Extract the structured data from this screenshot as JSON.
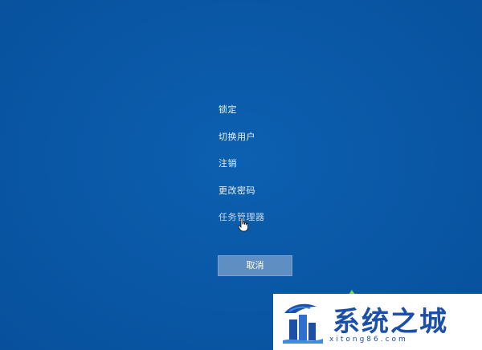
{
  "menu": {
    "items": [
      {
        "label": "锁定"
      },
      {
        "label": "切换用户"
      },
      {
        "label": "注销"
      },
      {
        "label": "更改密码"
      },
      {
        "label": "任务管理器"
      }
    ]
  },
  "cancel_label": "取消",
  "watermark": {
    "title": "系统之城",
    "subtitle": "xitong86.com"
  },
  "colors": {
    "background": "#0a5aa8",
    "button": "#5f8fc2",
    "watermark_text": "#1c4fa8"
  },
  "cursor": "hand-pointer-icon"
}
